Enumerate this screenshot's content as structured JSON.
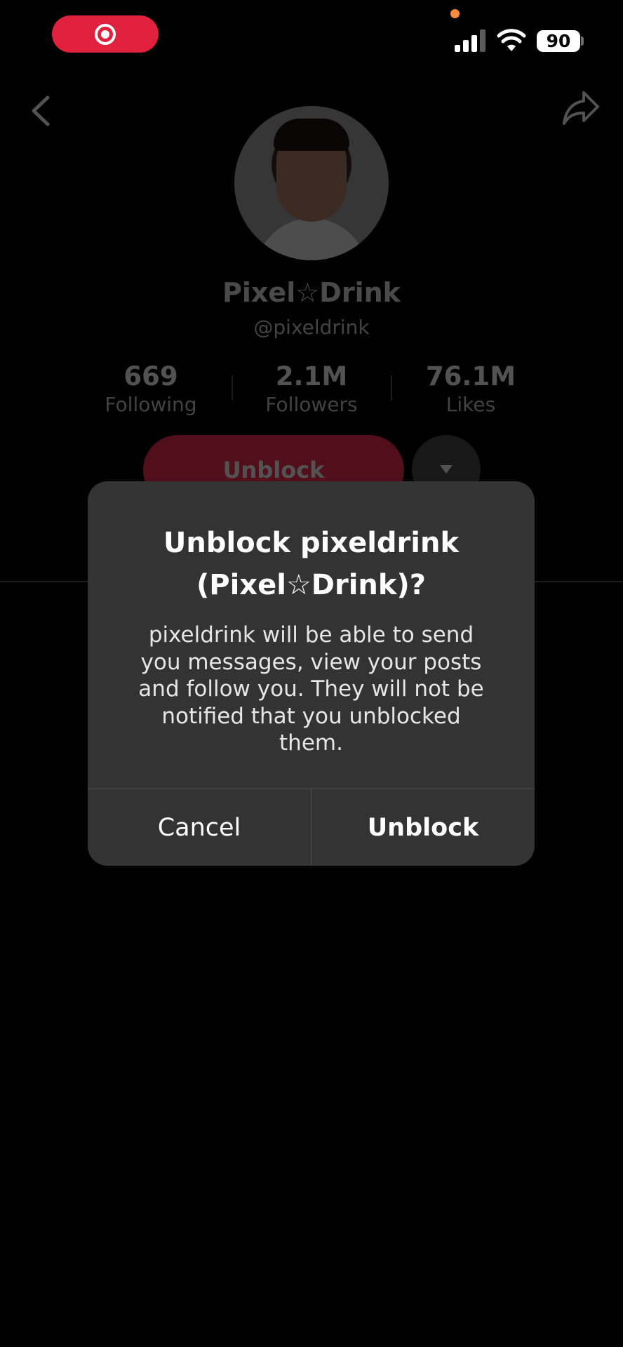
{
  "status_bar": {
    "battery": "90",
    "icons": [
      "screen-record-icon",
      "cellular-signal-icon",
      "wifi-icon",
      "battery-icon"
    ],
    "record_color": "#e0203c"
  },
  "profile": {
    "display_name": "Pixel☆Drink",
    "username": "@pixeldrink",
    "stats": [
      {
        "value": "669",
        "label": "Following"
      },
      {
        "value": "2.1M",
        "label": "Followers"
      },
      {
        "value": "76.1M",
        "label": "Likes"
      }
    ],
    "unblock_label": "Unblock",
    "accent": "#fe2c55"
  },
  "dialog": {
    "title": "Unblock pixeldrink (Pixel☆Drink)?",
    "message": "pixeldrink will be able to send you messages, view your posts and follow you. They will not be notified that you unblocked them.",
    "cancel_label": "Cancel",
    "confirm_label": "Unblock"
  }
}
